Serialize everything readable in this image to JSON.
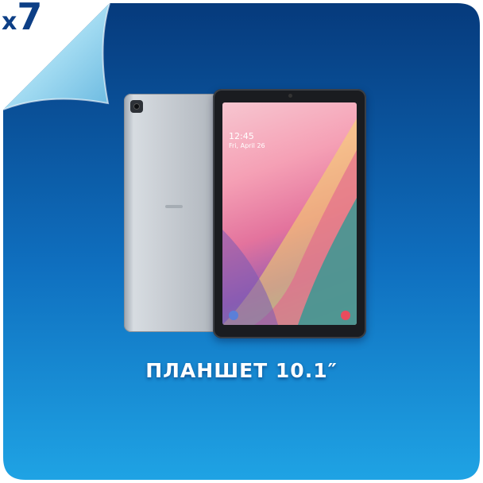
{
  "badge": {
    "multiplier_prefix": "x",
    "multiplier_number": "7"
  },
  "caption": "ПЛАНШЕТ 10.1″",
  "device_screen": {
    "clock": "12:45",
    "date": "Fri, April 26"
  },
  "colors": {
    "card_top": "#063a7c",
    "card_bottom": "#1fa3e4",
    "corner_fold": "#9fd8ef",
    "badge_text": "#0d3f86",
    "caption_text": "#ffffff"
  },
  "icons": [
    "tablet-back-image",
    "tablet-front-image",
    "rear-camera-icon"
  ]
}
